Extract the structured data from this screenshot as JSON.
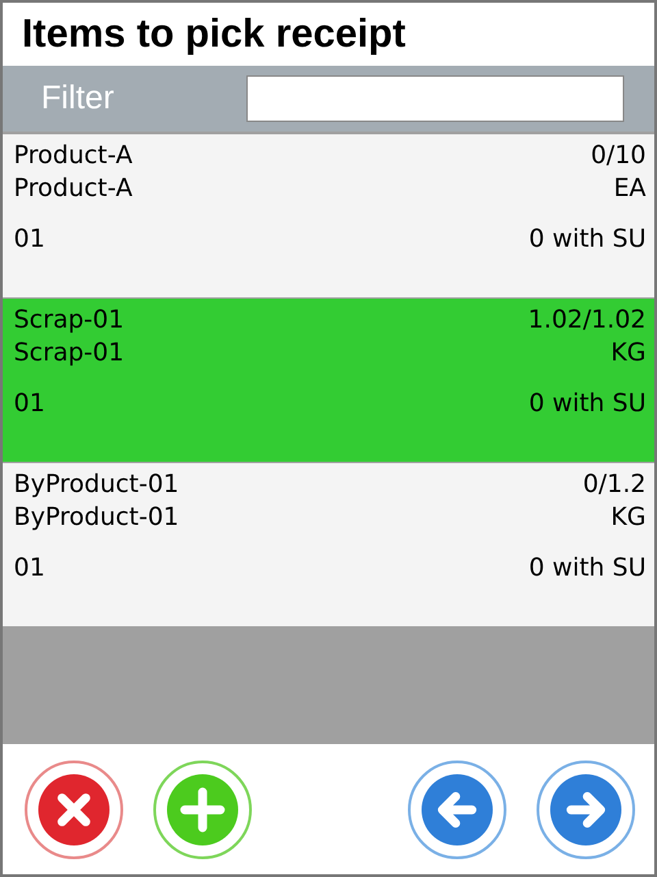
{
  "title": "Items to pick receipt",
  "filter": {
    "label": "Filter"
  },
  "items": [
    {
      "name": "Product-A",
      "description": "Product-A",
      "quantity": "0/10",
      "unit": "EA",
      "batch": "01",
      "su_count": "0 with SU",
      "complete": false
    },
    {
      "name": "Scrap-01",
      "description": "Scrap-01",
      "quantity": "1.02/1.02",
      "unit": "KG",
      "batch": "01",
      "su_count": "0 with SU",
      "complete": true
    },
    {
      "name": "ByProduct-01",
      "description": "ByProduct-01",
      "quantity": "0/1.2",
      "unit": "KG",
      "batch": "01",
      "su_count": "0 with SU",
      "complete": false
    }
  ],
  "buttons": [
    {
      "kind": "cancel"
    },
    {
      "kind": "add"
    },
    {
      "kind": "back"
    },
    {
      "kind": "forward"
    }
  ]
}
